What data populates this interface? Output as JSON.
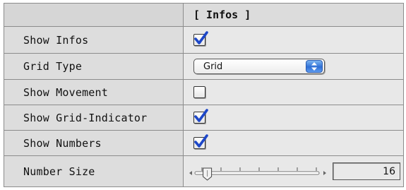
{
  "header": {
    "title": "[ Infos ]"
  },
  "rows": [
    {
      "label": "Show Infos",
      "type": "checkbox",
      "checked": true
    },
    {
      "label": "Grid Type",
      "type": "popup",
      "value": "Grid"
    },
    {
      "label": "Show Movement",
      "type": "checkbox",
      "checked": false
    },
    {
      "label": "Show Grid-Indicator",
      "type": "checkbox",
      "checked": true
    },
    {
      "label": "Show Numbers",
      "type": "checkbox",
      "checked": true
    },
    {
      "label": "Number Size",
      "type": "slider",
      "value": "16",
      "slider_fraction": 0.1
    }
  ],
  "colors": {
    "check": "#1d47c8",
    "popup_accent": "#2f6fd6"
  },
  "icons": {
    "checkmark": "checkmark-icon",
    "popup_arrows": "up-down-arrows-icon",
    "slider_left": "slider-left-arrow-icon",
    "slider_right": "slider-right-arrow-icon"
  }
}
